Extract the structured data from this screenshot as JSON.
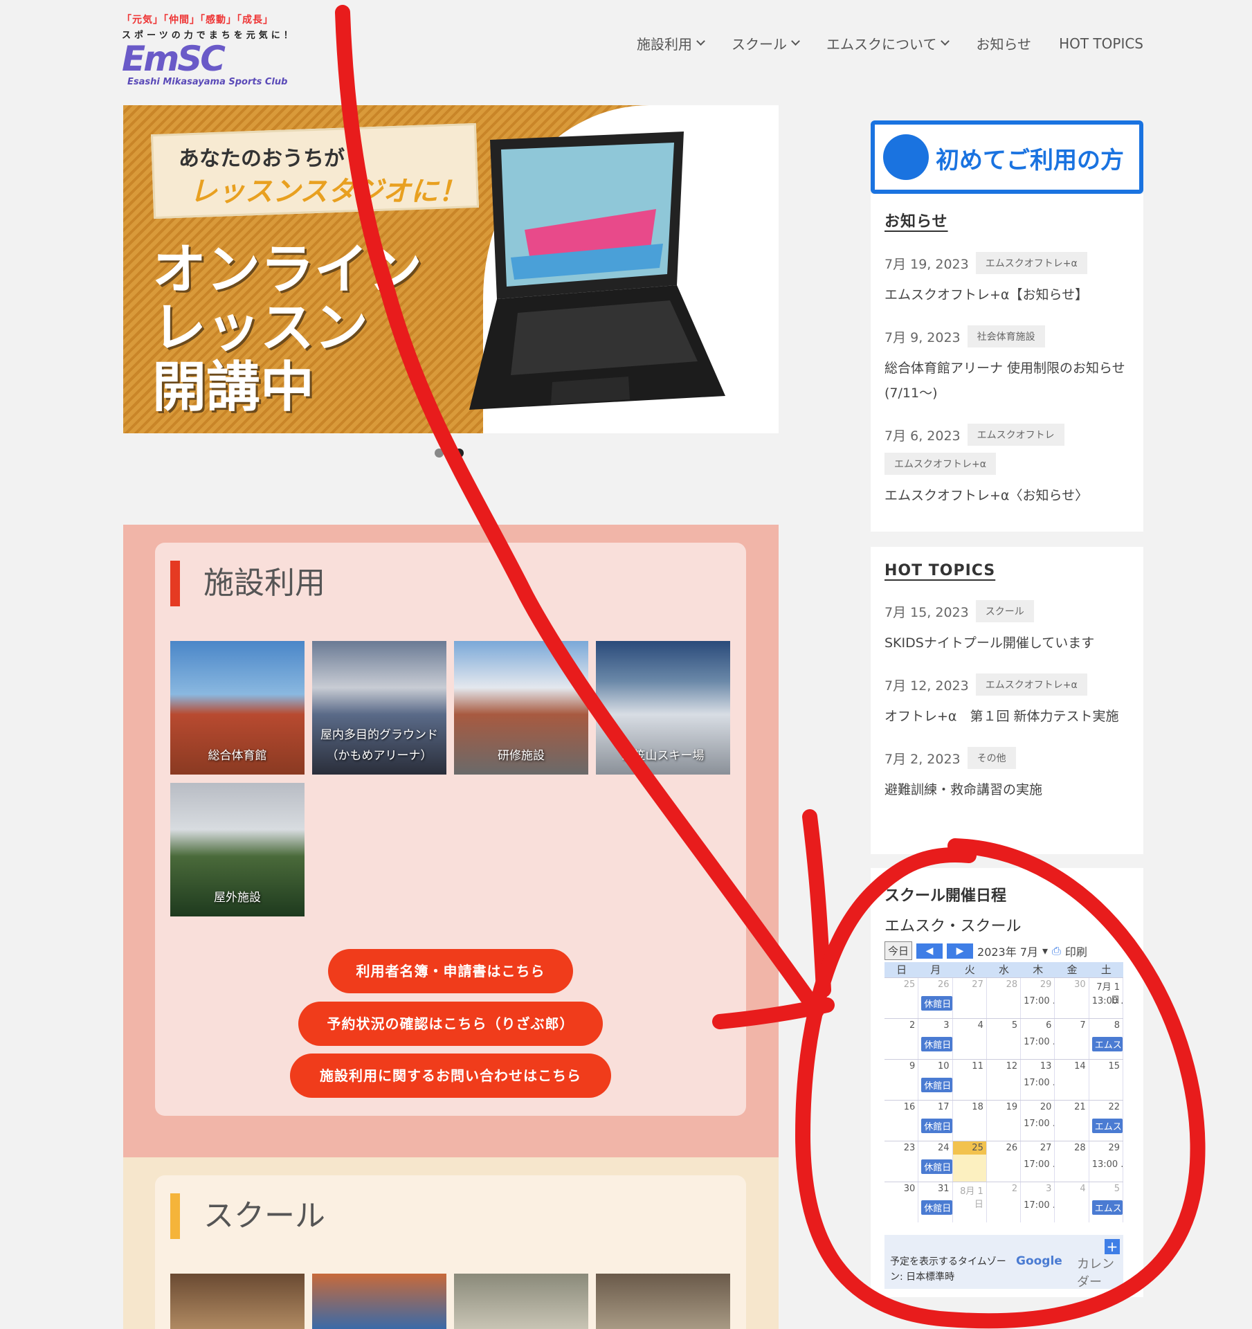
{
  "header": {
    "slogan1": "「元気」「仲間」「感動」「成長」",
    "slogan2": "スポーツの力でまちを元気に！",
    "logo_mark": "EmSC",
    "logo_sub": "Esashi Mikasayama Sports Club",
    "nav": [
      {
        "label": "施設利用"
      },
      {
        "label": "スクール"
      },
      {
        "label": "エムスクについて"
      },
      {
        "label": "お知らせ"
      },
      {
        "label": "HOT TOPICS"
      }
    ]
  },
  "hero": {
    "line1": "あなたのおうちが",
    "line2": "レッスンスタジオに！",
    "big1": "オンライン",
    "big2": "レッスン",
    "big3": "開講中"
  },
  "facility": {
    "title": "施設利用",
    "items": [
      {
        "caption": "総合体育館"
      },
      {
        "caption": "屋内多目的グラウンド（かもめアリーナ）"
      },
      {
        "caption": "研修施設"
      },
      {
        "caption": "三笠山スキー場"
      },
      {
        "caption": "屋外施設"
      }
    ],
    "buttons": [
      {
        "label": "利用者名簿・申請書はこちら"
      },
      {
        "label": "予約状況の確認はこちら（りざぶ郎）"
      },
      {
        "label": "施設利用に関するお問い合わせはこちら"
      }
    ]
  },
  "school": {
    "title": "スクール"
  },
  "sidebar": {
    "first_time": "初めてご利用の方",
    "news": {
      "title": "お知らせ",
      "posts": [
        {
          "date": "7月 19, 2023",
          "tags": [
            "エムスクオフトレ+α"
          ],
          "title": "エムスクオフトレ+α【お知らせ】"
        },
        {
          "date": "7月 9, 2023",
          "tags": [
            "社会体育施設"
          ],
          "title": "総合体育館アリーナ 使用制限のお知らせ(7/11〜)"
        },
        {
          "date": "7月 6, 2023",
          "tags": [
            "エムスクオフトレ",
            "エムスクオフトレ+α"
          ],
          "title": "エムスクオフトレ+α〈お知らせ〉"
        }
      ]
    },
    "hot": {
      "title": "HOT TOPICS",
      "posts": [
        {
          "date": "7月 15, 2023",
          "tags": [
            "スクール"
          ],
          "title": "SKIDSナイトプール開催しています"
        },
        {
          "date": "7月 12, 2023",
          "tags": [
            "エムスクオフトレ+α"
          ],
          "title": "オフトレ+α　第１回 新体力テスト実施"
        },
        {
          "date": "7月 2, 2023",
          "tags": [
            "その他"
          ],
          "title": "避難訓練・救命講習の実施"
        }
      ]
    },
    "calendar": {
      "title": "スクール開催日程",
      "subtitle": "エムスク・スクール",
      "today": "今日",
      "month": "2023年 7月",
      "print": "印刷",
      "dow": [
        "日",
        "月",
        "火",
        "水",
        "木",
        "金",
        "土"
      ],
      "weeks": [
        [
          {
            "d": "25",
            "o": true
          },
          {
            "d": "26",
            "o": true,
            "e": "休館日",
            "b": true
          },
          {
            "d": "27",
            "o": true
          },
          {
            "d": "28",
            "o": true
          },
          {
            "d": "29",
            "o": true,
            "e": "17:00 ..."
          },
          {
            "d": "30",
            "o": true
          },
          {
            "d": "7月 1日",
            "e": "13:00 ..."
          }
        ],
        [
          {
            "d": "2"
          },
          {
            "d": "3",
            "e": "休館日",
            "b": true
          },
          {
            "d": "4"
          },
          {
            "d": "5"
          },
          {
            "d": "6",
            "e": "17:00 ..."
          },
          {
            "d": "7"
          },
          {
            "d": "8",
            "e": "エムス",
            "b": true
          }
        ],
        [
          {
            "d": "9"
          },
          {
            "d": "10",
            "e": "休館日",
            "b": true
          },
          {
            "d": "11"
          },
          {
            "d": "12"
          },
          {
            "d": "13",
            "e": "17:00 ..."
          },
          {
            "d": "14"
          },
          {
            "d": "15"
          }
        ],
        [
          {
            "d": "16"
          },
          {
            "d": "17",
            "e": "休館日",
            "b": true
          },
          {
            "d": "18"
          },
          {
            "d": "19"
          },
          {
            "d": "20",
            "e": "17:00 ..."
          },
          {
            "d": "21"
          },
          {
            "d": "22",
            "e": "エムス",
            "b": true
          }
        ],
        [
          {
            "d": "23"
          },
          {
            "d": "24",
            "e": "休館日",
            "b": true
          },
          {
            "d": "25",
            "t": true
          },
          {
            "d": "26"
          },
          {
            "d": "27",
            "e": "17:00 ..."
          },
          {
            "d": "28"
          },
          {
            "d": "29",
            "e": "13:00 ..."
          }
        ],
        [
          {
            "d": "30"
          },
          {
            "d": "31",
            "e": "休館日",
            "b": true
          },
          {
            "d": "8月 1日",
            "o": true
          },
          {
            "d": "2",
            "o": true
          },
          {
            "d": "3",
            "o": true,
            "e": "17:00 ..."
          },
          {
            "d": "4",
            "o": true
          },
          {
            "d": "5",
            "o": true,
            "e": "エムス",
            "b": true
          }
        ]
      ],
      "timezone": "予定を表示するタイムゾーン: 日本標準時",
      "google": "Google",
      "calendar_label": "カレンダー"
    }
  },
  "colors": {
    "accent_red": "#f03c1b",
    "brand_blue": "#1a73e0",
    "annotation_red": "#e81c1c"
  }
}
